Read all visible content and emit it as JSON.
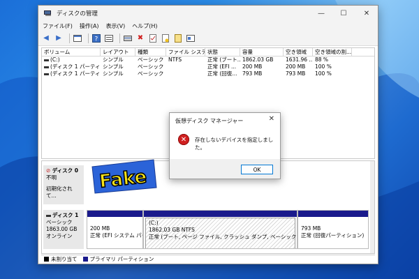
{
  "window": {
    "title": "ディスクの管理",
    "controls": {
      "minimize": "—",
      "maximize": "☐",
      "close": "✕"
    }
  },
  "menu": [
    "ファイル(F)",
    "操作(A)",
    "表示(V)",
    "ヘルプ(H)"
  ],
  "toolbar_icons": [
    "back-arrow-icon",
    "forward-arrow-icon",
    "console-tree-icon",
    "help-icon",
    "properties-icon",
    "disk-icon",
    "delete-icon",
    "check-icon",
    "new-file-icon",
    "search-icon",
    "action-icon"
  ],
  "volumes": {
    "headers": [
      "ボリューム",
      "レイアウト",
      "種類",
      "ファイル システム",
      "状態",
      "容量",
      "空き領域",
      "空き領域の割...",
      ""
    ],
    "rows": [
      [
        "(C:)",
        "シンプル",
        "ベーシック",
        "NTFS",
        "正常 (ブート...",
        "1862.03 GB",
        "1631.96 ...",
        "88 %"
      ],
      [
        "(ディスク 1 パーティシ...",
        "シンプル",
        "ベーシック",
        "",
        "正常 (EFI ...",
        "200 MB",
        "200 MB",
        "100 %"
      ],
      [
        "(ディスク 1 パーティシ...",
        "シンプル",
        "ベーシック",
        "",
        "正常 (回復...",
        "793 MB",
        "793 MB",
        "100 %"
      ]
    ]
  },
  "disks": [
    {
      "name": "ディスク 0",
      "lines": [
        "不明",
        "初期化されて..."
      ]
    },
    {
      "name": "ディスク 1",
      "lines": [
        "ベーシック",
        "1863.00 GB",
        "オンライン"
      ]
    }
  ],
  "partitions": [
    {
      "line1": "200 MB",
      "line2": "正常 (EFI システム パー"
    },
    {
      "line1": "(C:)",
      "line2": "1862.03 GB NTFS",
      "line3": "正常 (ブート, ページ ファイル, クラッシュ ダンプ, ベーシック データ パーティ"
    },
    {
      "line1": "793 MB",
      "line2": "正常 (回復パーティション)"
    }
  ],
  "legend": [
    "未割り当て",
    "プライマリ パーティション"
  ],
  "dialog": {
    "title": "仮想ディスク マネージャー",
    "message": "存在しないデバイスを指定しました。",
    "ok": "OK"
  },
  "overlay": {
    "fake": "Fake"
  },
  "colors": {
    "partition_bar": "#1a1a8c",
    "unallocated": "#000000",
    "primary": "#1a1a8c",
    "error": "#d12020",
    "fake_yellow": "#f6e21a"
  }
}
